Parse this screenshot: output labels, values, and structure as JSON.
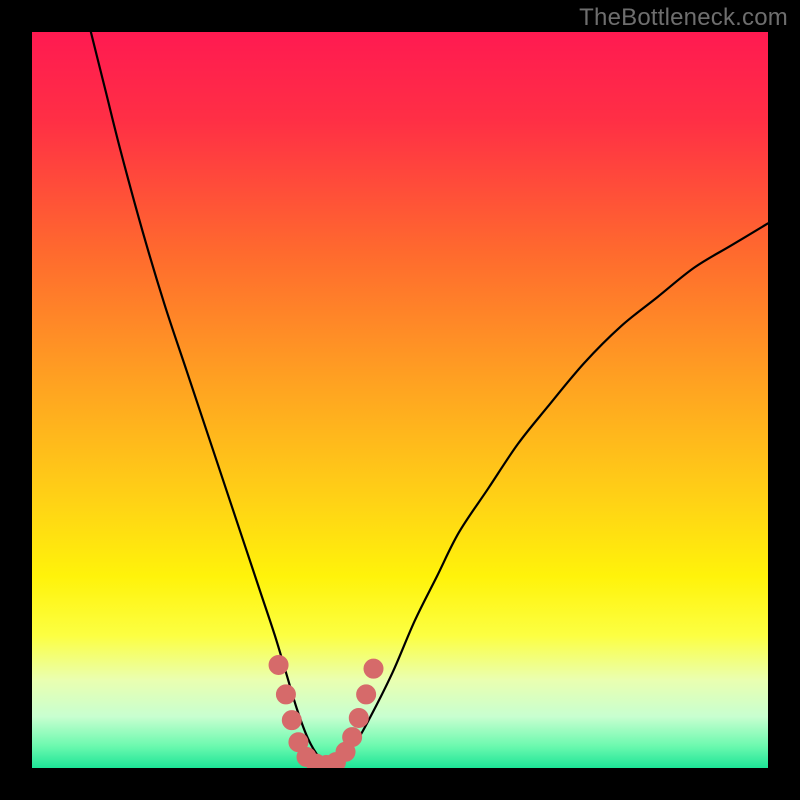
{
  "watermark": "TheBottleneck.com",
  "colors": {
    "frame": "#000000",
    "gradient_stops": [
      {
        "offset": 0.0,
        "color": "#ff1a51"
      },
      {
        "offset": 0.12,
        "color": "#ff2f45"
      },
      {
        "offset": 0.3,
        "color": "#ff6a2e"
      },
      {
        "offset": 0.48,
        "color": "#ffa321"
      },
      {
        "offset": 0.63,
        "color": "#ffd016"
      },
      {
        "offset": 0.74,
        "color": "#fff30a"
      },
      {
        "offset": 0.82,
        "color": "#fcff42"
      },
      {
        "offset": 0.88,
        "color": "#eaffb0"
      },
      {
        "offset": 0.93,
        "color": "#c8ffd0"
      },
      {
        "offset": 0.97,
        "color": "#6cf9af"
      },
      {
        "offset": 1.0,
        "color": "#1de597"
      }
    ],
    "curve": "#000000",
    "marker_fill": "#d66a6a",
    "marker_stroke": "#d66a6a"
  },
  "chart_data": {
    "type": "line",
    "title": "",
    "xlabel": "",
    "ylabel": "",
    "xlim": [
      0,
      100
    ],
    "ylim": [
      0,
      100
    ],
    "grid": false,
    "legend": false,
    "series": [
      {
        "name": "bottleneck-curve",
        "x": [
          8,
          10,
          12,
          15,
          18,
          21,
          24,
          27,
          29,
          31,
          33,
          34.5,
          36,
          37.5,
          39,
          40.5,
          42,
          44,
          46,
          49,
          52,
          55,
          58,
          62,
          66,
          70,
          75,
          80,
          85,
          90,
          95,
          100
        ],
        "y": [
          100,
          92,
          84,
          73,
          63,
          54,
          45,
          36,
          30,
          24,
          18,
          13,
          8,
          4,
          1.5,
          0.5,
          1.5,
          3.5,
          7,
          13,
          20,
          26,
          32,
          38,
          44,
          49,
          55,
          60,
          64,
          68,
          71,
          74
        ]
      }
    ],
    "markers": {
      "name": "highlight-points",
      "points": [
        {
          "x": 33.5,
          "y": 14
        },
        {
          "x": 34.5,
          "y": 10
        },
        {
          "x": 35.3,
          "y": 6.5
        },
        {
          "x": 36.2,
          "y": 3.5
        },
        {
          "x": 37.3,
          "y": 1.5
        },
        {
          "x": 38.6,
          "y": 0.6
        },
        {
          "x": 40.0,
          "y": 0.4
        },
        {
          "x": 41.3,
          "y": 0.8
        },
        {
          "x": 42.6,
          "y": 2.2
        },
        {
          "x": 43.5,
          "y": 4.2
        },
        {
          "x": 44.4,
          "y": 6.8
        },
        {
          "x": 45.4,
          "y": 10.0
        },
        {
          "x": 46.4,
          "y": 13.5
        }
      ],
      "radius": 9.5
    }
  }
}
